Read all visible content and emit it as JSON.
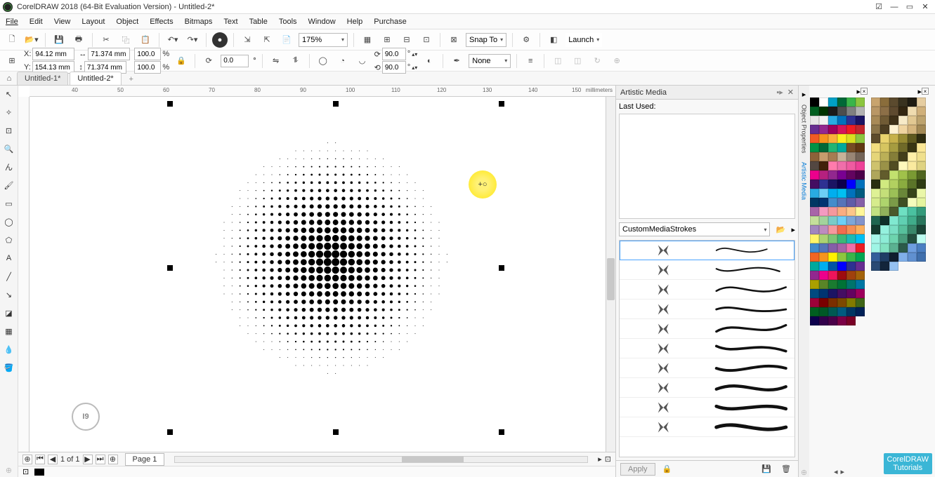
{
  "app": {
    "title": "CorelDRAW 2018 (64-Bit Evaluation Version) - Untitled-2*"
  },
  "menu": [
    "File",
    "Edit",
    "View",
    "Layout",
    "Object",
    "Effects",
    "Bitmaps",
    "Text",
    "Table",
    "Tools",
    "Window",
    "Help",
    "Purchase"
  ],
  "toolbar1": {
    "zoom": "175%",
    "snap": "Snap To",
    "launch": "Launch"
  },
  "toolbar2": {
    "x_label": "X:",
    "x": "94.12 mm",
    "y_label": "Y:",
    "y": "154.13 mm",
    "w": "71.374 mm",
    "h": "71.374 mm",
    "sx": "100.0",
    "sy": "100.0",
    "pct": "%",
    "rot": "0.0",
    "deg": "°",
    "ang1": "90.0",
    "ang2": "90.0",
    "outline": "None"
  },
  "tabs": {
    "t1": "Untitled-1*",
    "t2": "Untitled-2*"
  },
  "ruler": {
    "unit": "millimeters",
    "t40": "40",
    "t50": "50",
    "t70": "70",
    "t80": "80",
    "t100": "100",
    "t130": "130",
    "t140": "140",
    "t150": "150",
    "t60": "60",
    "t90": "90",
    "t110": "110",
    "t120": "120"
  },
  "nav": {
    "pageinfo": "1  of  1",
    "pagename": "Page 1"
  },
  "hint": "I9",
  "artistic": {
    "title": "Artistic Media",
    "lastused_label": "Last Used:",
    "preset": "CustomMediaStrokes",
    "apply": "Apply"
  },
  "vtabs": {
    "a": "Object Properties",
    "b": "Artistic Media"
  },
  "corner": {
    "l1": "CorelDRAW",
    "l2": "Tutorials"
  },
  "palette1": [
    "#000000",
    "#ffffff",
    "#00a0c6",
    "#006837",
    "#39b54a",
    "#8cc63f",
    "#005e20",
    "#003300",
    "#1a1a1a",
    "#4d4d4d",
    "#808080",
    "#b3b3b3",
    "#e6e6e6",
    "#f2f2f2",
    "#29abe2",
    "#0071bc",
    "#2e3192",
    "#1b1464",
    "#662d91",
    "#93278f",
    "#9e005d",
    "#d4145a",
    "#ed1c24",
    "#c1272d",
    "#f15a24",
    "#f7931e",
    "#fbb03b",
    "#fcee21",
    "#d9e021",
    "#8cc63f",
    "#009245",
    "#006837",
    "#22b573",
    "#00a99d",
    "#754c24",
    "#603813",
    "#8c6239",
    "#c69c6d",
    "#a67c52",
    "#c7b299",
    "#998675",
    "#736357",
    "#534741",
    "#42210b",
    "#ff7bac",
    "#f06eaa",
    "#ef5ba1",
    "#ee4198",
    "#ec008c",
    "#b5217f",
    "#92278f",
    "#790091",
    "#630460",
    "#4b0049",
    "#440e62",
    "#2e3192",
    "#1b1464",
    "#0d004c",
    "#0000ff",
    "#0071bc",
    "#29abe2",
    "#6dcff6",
    "#00aeef",
    "#00bff3",
    "#0072bc",
    "#005b7f",
    "#003663",
    "#003471",
    "#448ccb",
    "#5674b9",
    "#605ca8",
    "#8560a8",
    "#a864a8",
    "#f49ac1",
    "#f5989d",
    "#f9ad81",
    "#fdc689",
    "#fff799",
    "#c4df9b",
    "#a3d39c",
    "#7accc8",
    "#6dcff6",
    "#7da7d9",
    "#8393ca",
    "#a186be",
    "#bd8cbf",
    "#f6989d",
    "#f26c4f",
    "#f68e56",
    "#fbaf5d",
    "#fff568",
    "#acd373",
    "#7cc576",
    "#3cb878",
    "#1cbbb4",
    "#00bff3",
    "#438ccb",
    "#5574b9",
    "#855fa8",
    "#a763a8",
    "#f06eaa",
    "#ed1c24",
    "#f26522",
    "#f7941d",
    "#fff200",
    "#8dc63f",
    "#39b54a",
    "#00a651",
    "#00a99d",
    "#00aeef",
    "#0054a6",
    "#0000ff",
    "#2e3192",
    "#662d91",
    "#92278f",
    "#ec008c",
    "#ed145b",
    "#9e0b0f",
    "#a0410d",
    "#a36209",
    "#aba000",
    "#598527",
    "#1a7b30",
    "#007236",
    "#00746b",
    "#0076a3",
    "#004a80",
    "#003471",
    "#1b1464",
    "#440e62",
    "#630460",
    "#9e005d",
    "#9e0039",
    "#790000",
    "#7b2e00",
    "#7d4900",
    "#827b00",
    "#406618",
    "#005e20",
    "#005826",
    "#005952",
    "#005b7f",
    "#003663",
    "#002157",
    "#0d004c",
    "#32004b",
    "#4b0049",
    "#7b0046",
    "#7a0026"
  ],
  "palette2": [
    "#c8a46e",
    "#8a6d3b",
    "#5b4a2e",
    "#39321f",
    "#1f1c12",
    "#e6cda0",
    "#b99766",
    "#8c6f47",
    "#5e4a2f",
    "#332611",
    "#f0dcb0",
    "#d0b07a",
    "#a88a57",
    "#705b35",
    "#3f3118",
    "#f7eac8",
    "#e2c892",
    "#bda36e",
    "#8c7549",
    "#4d3e22",
    "#fff2d1",
    "#f0d4a0",
    "#d6b67e",
    "#a38955",
    "#5d4b2b",
    "#ead46e",
    "#c6b14a",
    "#968a33",
    "#5f591f",
    "#2f2c10",
    "#f3dd80",
    "#d6c560",
    "#a69c40",
    "#706a29",
    "#3a3613",
    "#fbe795",
    "#e5d579",
    "#bbb057",
    "#857e39",
    "#443f1a",
    "#fff0a8",
    "#f0e08d",
    "#cec26d",
    "#9a9248",
    "#524d22",
    "#fff8bc",
    "#faea9f",
    "#dfd382",
    "#afa65b",
    "#625c2c",
    "#c2e06e",
    "#a0c14a",
    "#7a9a33",
    "#4f651f",
    "#292f10",
    "#d0e980",
    "#b2d060",
    "#8aac40",
    "#5b7429",
    "#2e3b13",
    "#def195",
    "#c4df79",
    "#9cc057",
    "#6a8739",
    "#36441a",
    "#eaf7a8",
    "#d6ec8d",
    "#aed46d",
    "#7b9b48",
    "#3f4f22",
    "#f4fcbc",
    "#e5f59f",
    "#c1e282",
    "#91b15b",
    "#4a5a2c",
    "#6ee0c2",
    "#4ac1a0",
    "#339a7a",
    "#1f654f",
    "#102f29",
    "#80e9d0",
    "#60d0b2",
    "#40ac8a",
    "#29745b",
    "#133b2e",
    "#95f1de",
    "#79dfc4",
    "#57c09c",
    "#39876a",
    "#1a4436",
    "#a8f7ea",
    "#8decd6",
    "#6dd4ae",
    "#489b7b",
    "#224f3f",
    "#bcfcf0",
    "#9ff5e5",
    "#82e2c1",
    "#5bb191",
    "#2c5a4a",
    "#6e9ee0",
    "#4a7ec1",
    "#335f9a",
    "#1f3e65",
    "#101e2f",
    "#80afe9",
    "#6090d0",
    "#406fac",
    "#294a74",
    "#13253b",
    "#95c1f1"
  ]
}
